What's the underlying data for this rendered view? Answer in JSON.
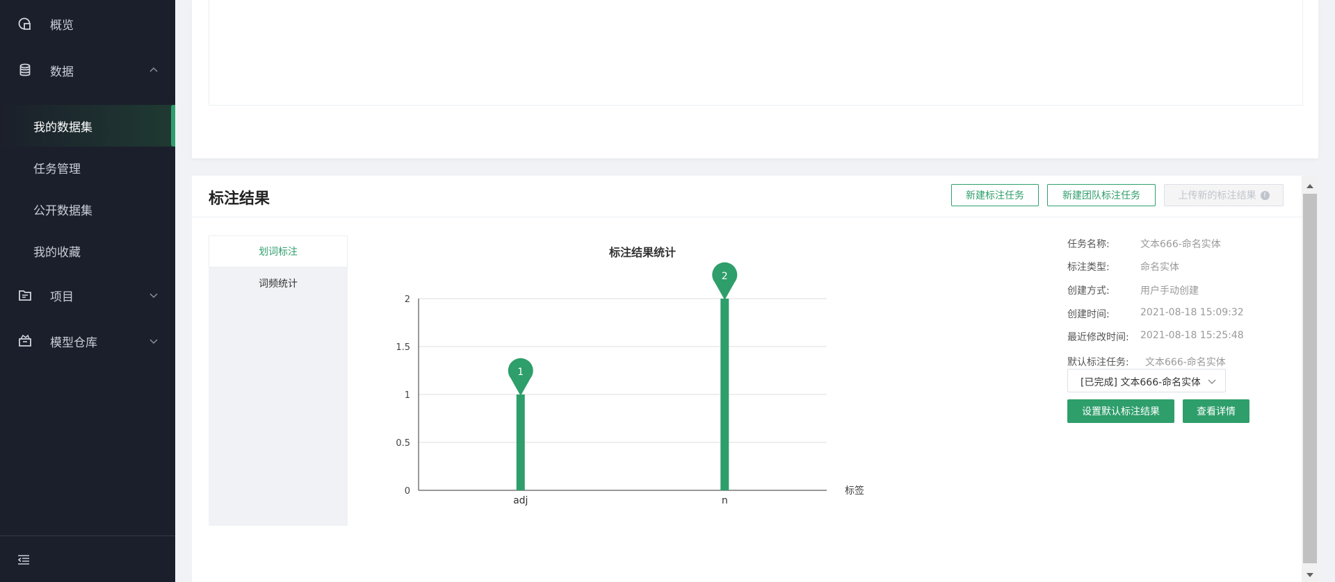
{
  "sidebar": {
    "items": [
      {
        "label": "概览",
        "icon": "overview-icon"
      },
      {
        "label": "数据",
        "icon": "database-icon"
      },
      {
        "label": "项目",
        "icon": "project-icon"
      },
      {
        "label": "模型仓库",
        "icon": "model-repo-icon"
      }
    ],
    "sub_items": [
      {
        "label": "我的数据集",
        "active": true
      },
      {
        "label": "任务管理"
      },
      {
        "label": "公开数据集"
      },
      {
        "label": "我的收藏"
      }
    ]
  },
  "result": {
    "title": "标注结果",
    "buttons": {
      "new_task": "新建标注任务",
      "new_team_task": "新建团队标注任务",
      "upload": "上传新的标注结果"
    },
    "tabs": [
      "划词标注",
      "词频统计"
    ]
  },
  "info": {
    "rows": [
      {
        "key": "任务名称:",
        "value": "文本666-命名实体"
      },
      {
        "key": "标注类型:",
        "value": "命名实体"
      },
      {
        "key": "创建方式:",
        "value": "用户手动创建"
      },
      {
        "key": "创建时间:",
        "value": "2021-08-18 15:09:32"
      },
      {
        "key": "最近修改时间:",
        "value": "2021-08-18 15:25:48"
      },
      {
        "key": "默认标注任务:",
        "value": "文本666-命名实体"
      }
    ],
    "select_value": "[已完成] 文本666-命名实体",
    "set_default_btn": "设置默认标注结果",
    "view_detail_btn": "查看详情"
  },
  "colors": {
    "accent": "#2e9e6b",
    "sidebar_bg": "#1b1f2b"
  },
  "chart_data": {
    "type": "bar",
    "title": "标注结果统计",
    "xlabel": "标签",
    "ylabel": "",
    "categories": [
      "adj",
      "n"
    ],
    "values": [
      1,
      2
    ],
    "ylim": [
      0,
      2
    ],
    "yticks": [
      "0",
      "0.5",
      "1",
      "1.5",
      "2"
    ],
    "grid": true,
    "data_labels": [
      "1",
      "2"
    ]
  }
}
